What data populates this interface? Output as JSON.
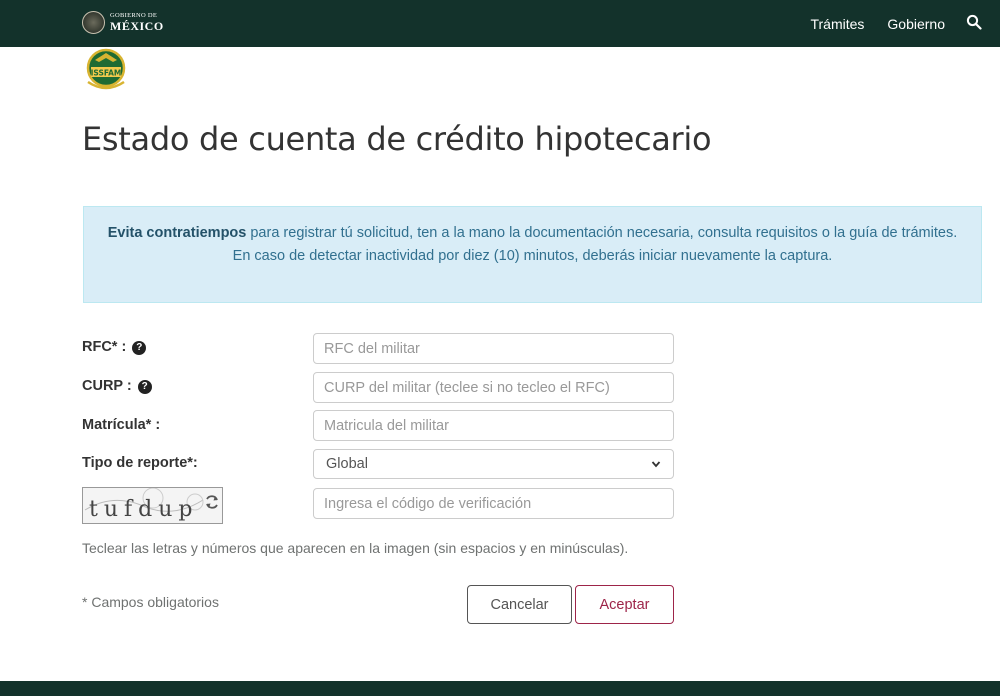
{
  "header": {
    "logo_small": "GOBIERNO DE",
    "logo_big": "MÉXICO",
    "nav": [
      "Trámites",
      "Gobierno"
    ],
    "search_icon": "search-icon"
  },
  "page": {
    "title": "Estado de cuenta de crédito hipotecario"
  },
  "alert": {
    "strong": "Evita contratiempos",
    "text1": " para registrar tú solicitud, ten a la mano la documentación necesaria, consulta requisitos o la guía de trámites.",
    "text2": "En caso de detectar inactividad por diez (10) minutos, deberás iniciar nuevamente la captura."
  },
  "form": {
    "rfc_label": "RFC* :",
    "rfc_placeholder": "RFC del militar",
    "curp_label": "CURP :",
    "curp_placeholder": "CURP del militar (teclee si no tecleo el RFC)",
    "matricula_label": "Matrícula* :",
    "matricula_placeholder": "Matricula del militar",
    "tipo_label": "Tipo de reporte*:",
    "tipo_value": "Global",
    "captcha_text": "tufdup",
    "captcha_placeholder": "Ingresa el código de verificación",
    "help_text": "Teclear las letras y números que aparecen en la imagen (sin espacios y en minúsculas).",
    "required_note": "* Campos obligatorios",
    "cancel_label": "Cancelar",
    "accept_label": "Aceptar"
  },
  "colors": {
    "header_bg": "#13322b",
    "accent": "#9d2449",
    "alert_bg": "#d9edf7",
    "alert_text": "#31708f"
  }
}
